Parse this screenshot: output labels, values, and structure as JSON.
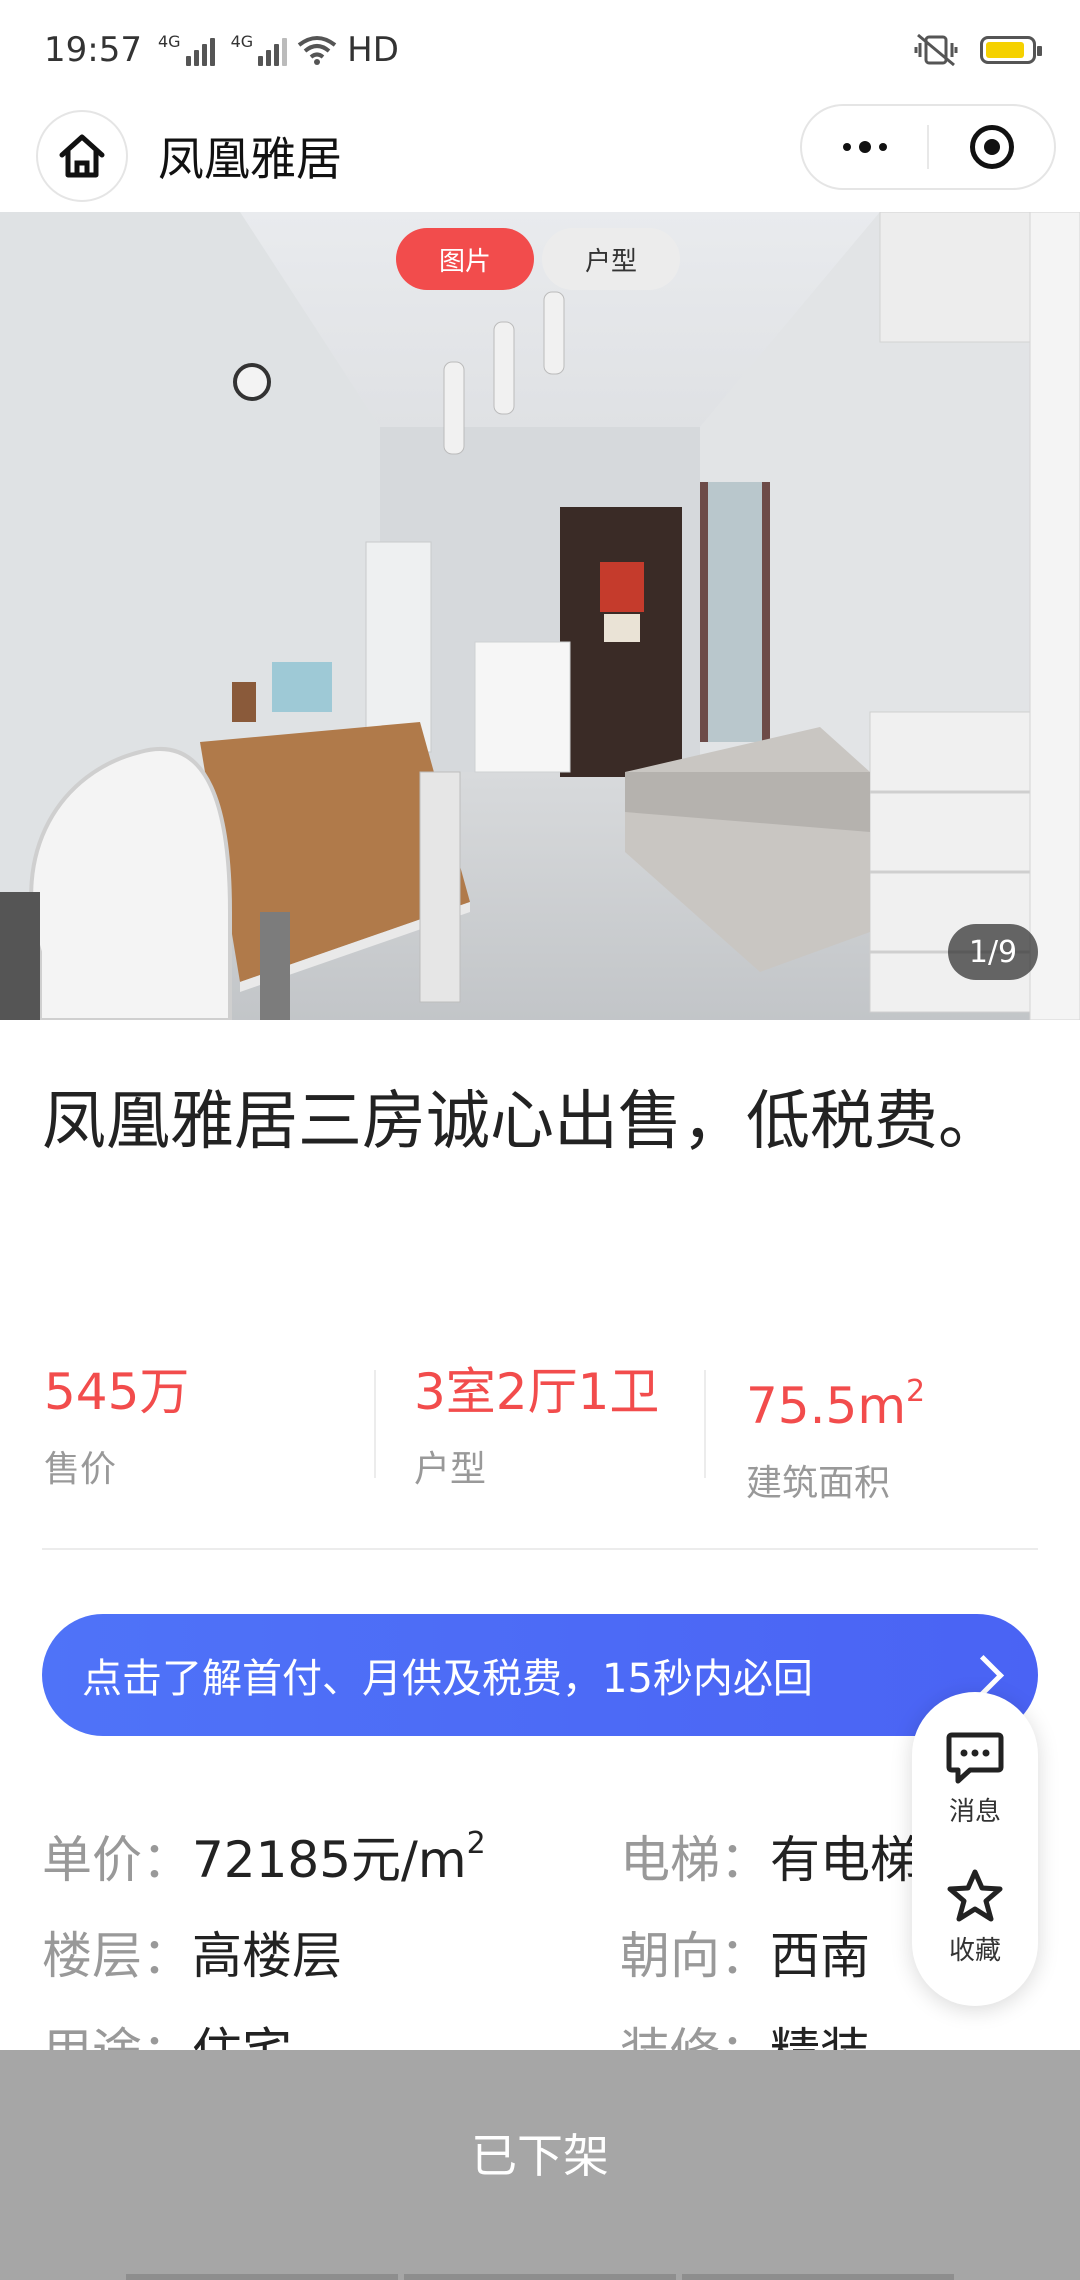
{
  "status_bar": {
    "time": "19:57",
    "network1": "4G",
    "network2": "4G",
    "hd_label": "HD",
    "icons": [
      "signal-icon",
      "wifi-icon",
      "vibrate-off-icon",
      "battery-icon"
    ],
    "battery_color": "#f5d100"
  },
  "header": {
    "title": "凤凰雅居",
    "home_icon": "home-icon",
    "menu_icon": "more-dots-icon",
    "close_icon": "target-icon"
  },
  "gallery": {
    "tabs": [
      {
        "label": "图片",
        "active": true
      },
      {
        "label": "户型",
        "active": false
      }
    ],
    "counter": "1/9"
  },
  "listing": {
    "title": "凤凰雅居三房诚心出售，低税费。"
  },
  "stats": [
    {
      "value": "545万",
      "label": "售价"
    },
    {
      "value": "3室2厅1卫",
      "label": "户型"
    },
    {
      "value": "75.5m",
      "value_sup": "2",
      "label": "建筑面积"
    }
  ],
  "banner": {
    "text": "点击了解首付、月供及税费，15秒内必回",
    "icon": "chevron-right-icon"
  },
  "details": {
    "unit_price_label": "单价：",
    "unit_price_value": "72185元/m",
    "unit_price_sup": "2",
    "elevator_label": "电梯：",
    "elevator_value": "有电梯",
    "floor_label": "楼层：",
    "floor_value": "高楼层",
    "orientation_label": "朝向：",
    "orientation_value": "西南",
    "usage_label": "用途：",
    "usage_value": "住宅",
    "decoration_label": "装修：",
    "decoration_value": "精装"
  },
  "fab": {
    "message_label": "消息",
    "favorite_label": "收藏"
  },
  "bottom_bar": {
    "status": "已下架"
  },
  "colors": {
    "accent_red": "#f24c4c",
    "banner_blue": "#4f73f8",
    "bottom_gray": "#a6a6a6"
  }
}
